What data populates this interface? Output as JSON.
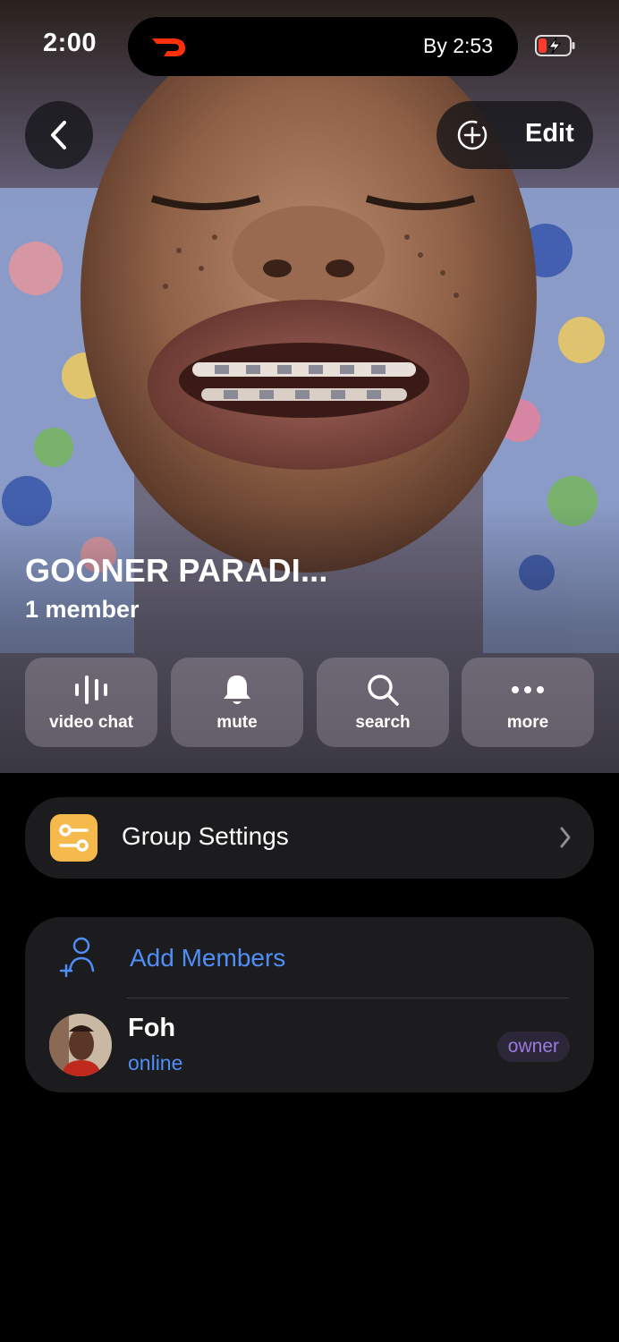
{
  "status_bar": {
    "time": "2:00",
    "live_activity_text": "By 2:53",
    "live_activity_app": "doordash-logo-icon",
    "battery": "battery-charging-low-icon"
  },
  "header": {
    "back_icon": "chevron-left-icon",
    "add_icon": "add-circle-icon",
    "edit_label": "Edit"
  },
  "group": {
    "title": "GOONER PARADI...",
    "member_count": "1 member"
  },
  "actions": [
    {
      "label": "video chat",
      "icon": "audio-bars-icon"
    },
    {
      "label": "mute",
      "icon": "bell-icon"
    },
    {
      "label": "search",
      "icon": "search-icon"
    },
    {
      "label": "more",
      "icon": "more-dots-icon"
    }
  ],
  "settings": {
    "label": "Group Settings",
    "icon": "toggles-icon"
  },
  "members": {
    "add_label": "Add Members",
    "list": [
      {
        "name": "Foh",
        "status": "online",
        "role": "owner"
      }
    ]
  },
  "colors": {
    "accent_blue": "#4f8ef7",
    "settings_icon_bg": "#f6b94c",
    "owner_text": "#9b7be0",
    "card_bg": "#1c1c1e"
  }
}
